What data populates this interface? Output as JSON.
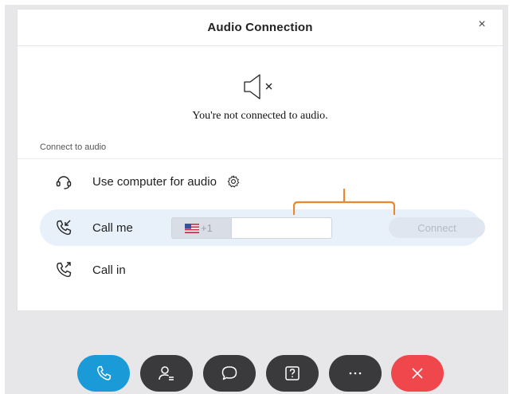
{
  "dialog": {
    "title": "Audio Connection",
    "close_label": "×"
  },
  "status": {
    "icon": "speaker-muted-icon",
    "text": "You're not connected to audio."
  },
  "connect_section": {
    "label": "Connect to audio",
    "options": [
      {
        "id": "computer",
        "label": "Use computer for audio",
        "icon": "headset-icon",
        "extra_icon": "gear-icon"
      },
      {
        "id": "callme",
        "label": "Call me",
        "icon": "phone-incoming-icon",
        "selected": true
      },
      {
        "id": "callin",
        "label": "Call in",
        "icon": "phone-outgoing-icon"
      }
    ],
    "call_me": {
      "country_flag": "us-flag-icon",
      "country_code": "+1",
      "phone_value": "",
      "connect_label": "Connect"
    }
  },
  "toolbar": {
    "buttons": [
      {
        "name": "audio-button",
        "icon": "phone-icon",
        "color": "#1a9bd7"
      },
      {
        "name": "participants-button",
        "icon": "participants-icon",
        "color": "#3a3a3c"
      },
      {
        "name": "chat-button",
        "icon": "chat-icon",
        "color": "#3a3a3c"
      },
      {
        "name": "qa-button",
        "icon": "question-icon",
        "color": "#3a3a3c"
      },
      {
        "name": "more-button",
        "icon": "more-icon",
        "color": "#3a3a3c"
      },
      {
        "name": "leave-button",
        "icon": "close-icon",
        "color": "#f0474d"
      }
    ]
  },
  "colors": {
    "accent": "#1a9bd7",
    "danger": "#f0474d",
    "annotation": "#e8892f",
    "selected_row": "#e8f0fa"
  }
}
